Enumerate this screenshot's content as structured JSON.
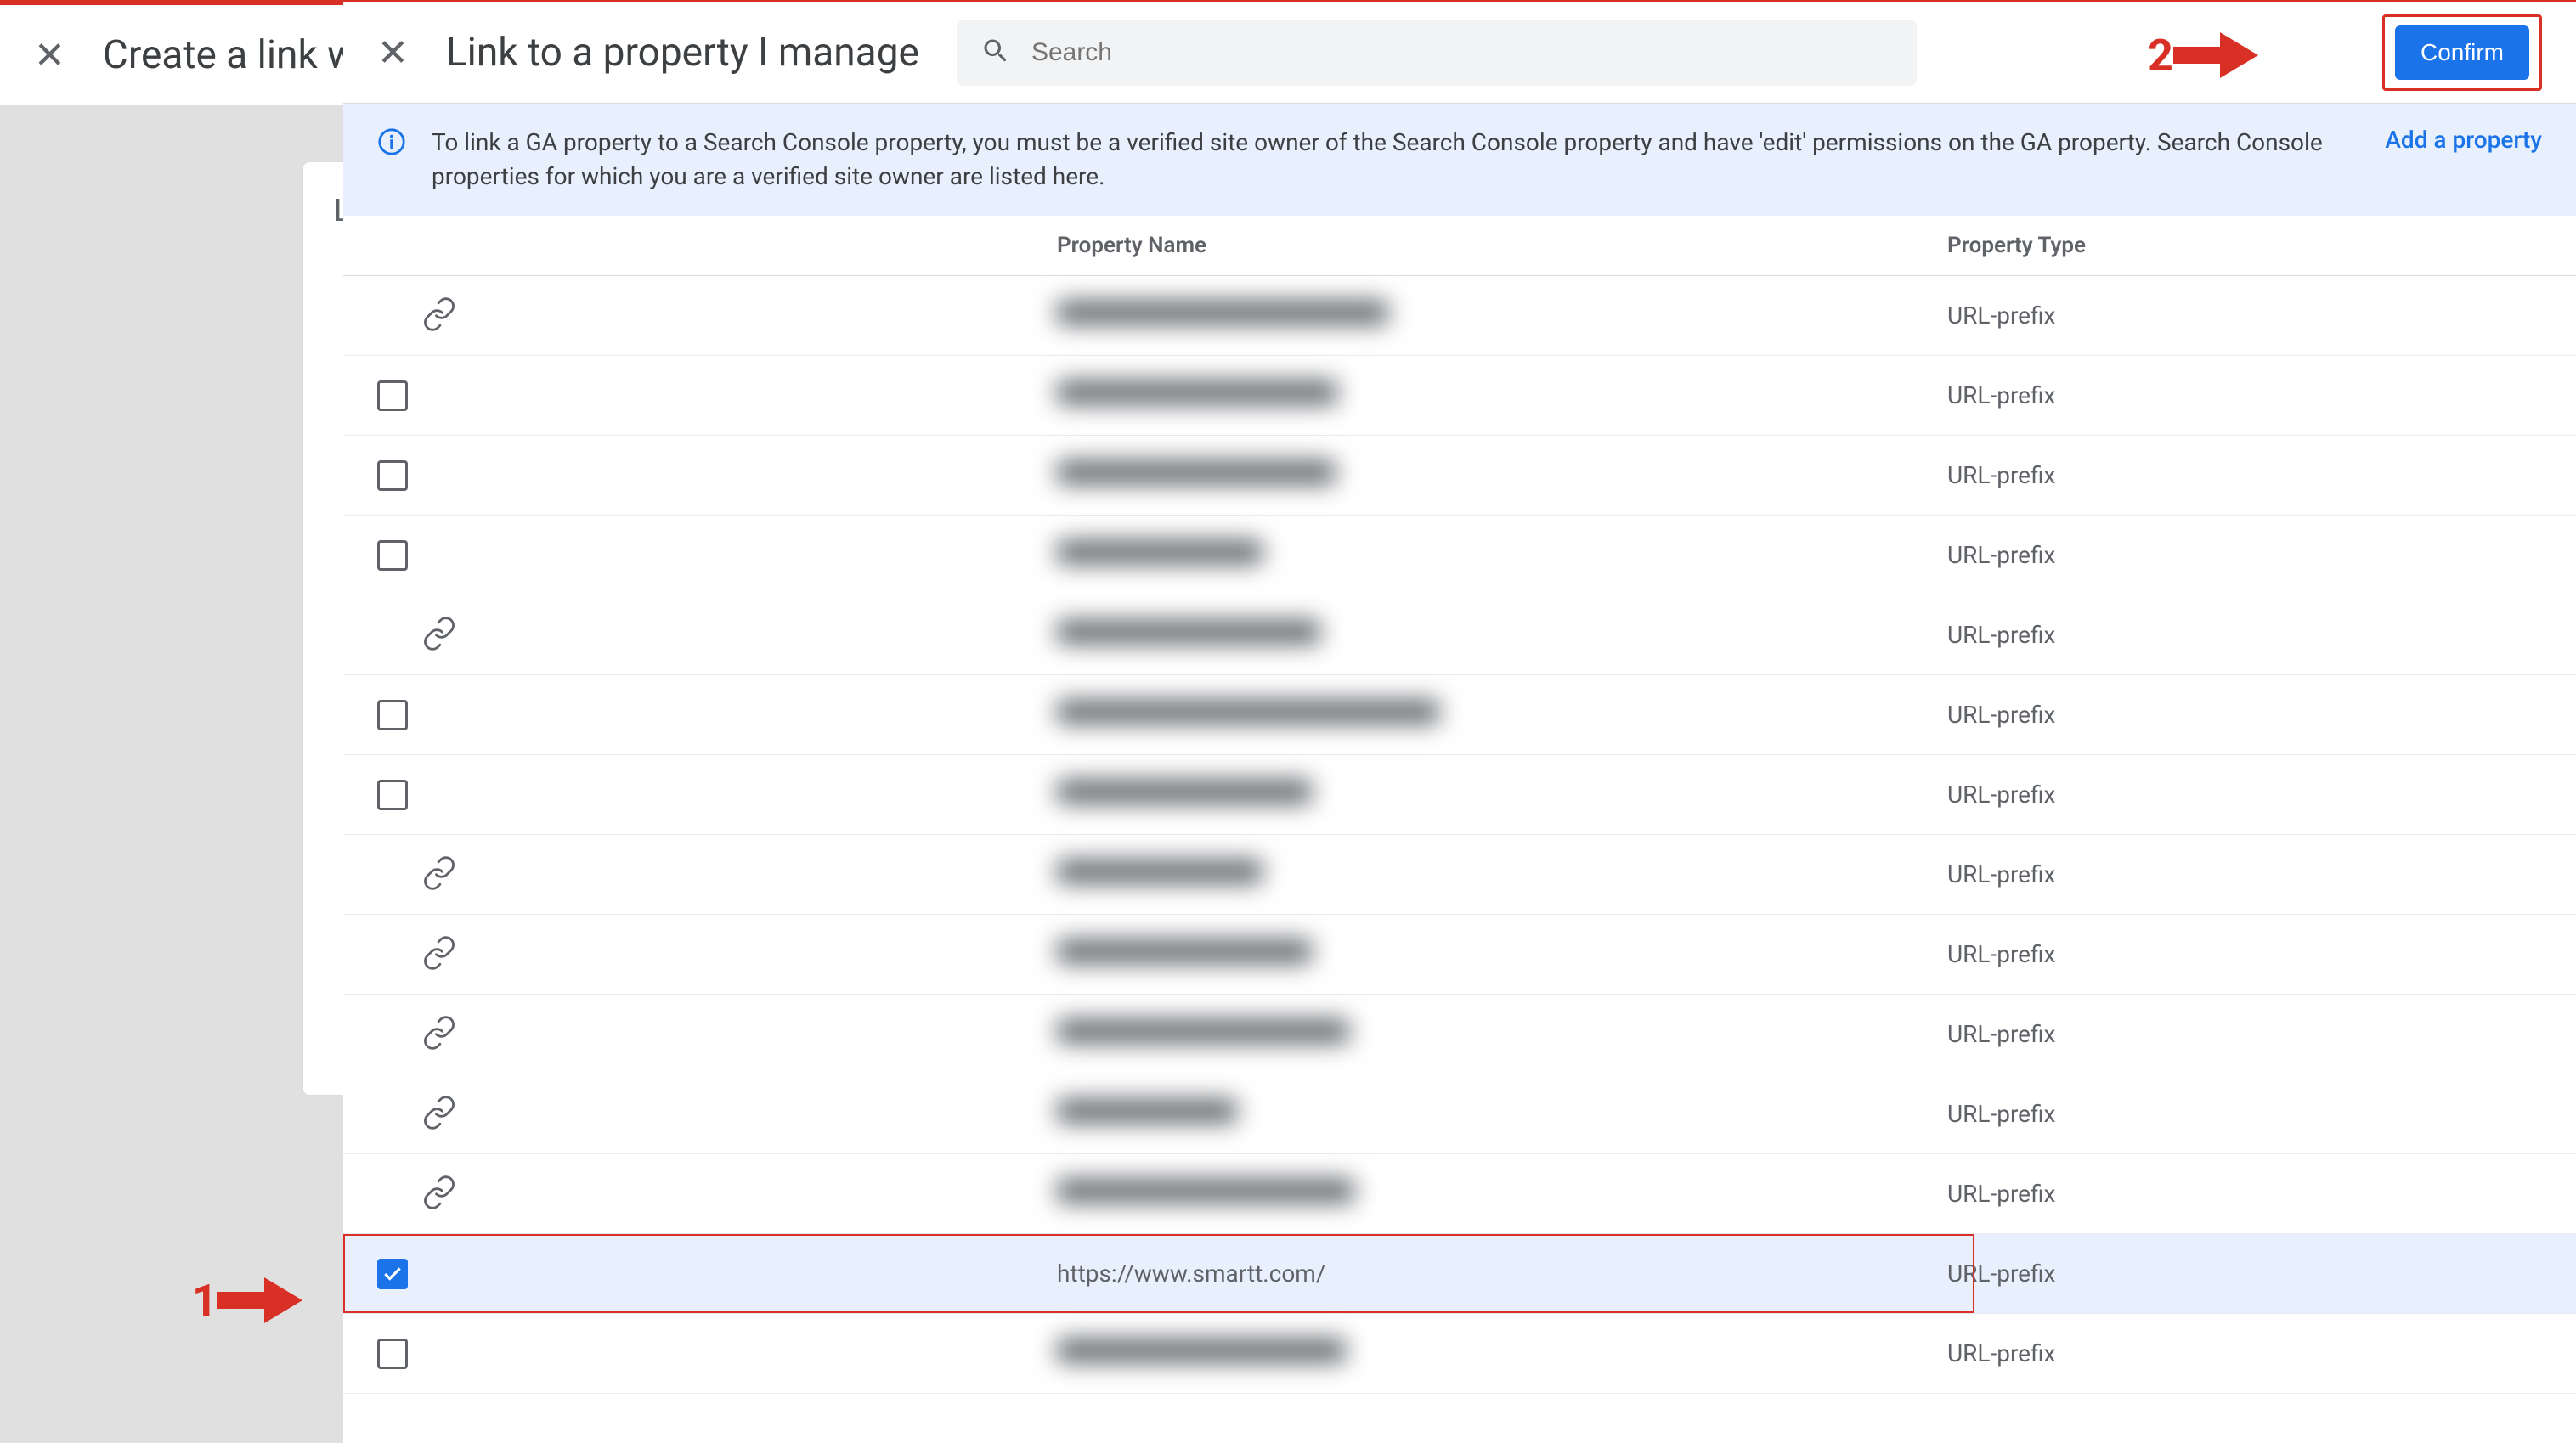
{
  "background": {
    "title": "Create a link w",
    "card_letter": "L"
  },
  "header": {
    "title": "Link to a property I manage",
    "search_placeholder": "Search",
    "confirm_label": "Confirm"
  },
  "info": {
    "text": "To link a GA property to a Search Console property, you must be a verified site owner of the Search Console property and have 'edit' permissions on the GA property. Search Console properties for which you are a verified site owner are listed here.",
    "add_link": "Add a property"
  },
  "table": {
    "name_header": "Property Name",
    "type_header": "Property Type"
  },
  "rows": [
    {
      "control": "link",
      "type": "URL-prefix",
      "name": "",
      "blurred": true,
      "bw": 390
    },
    {
      "control": "checkbox",
      "checked": false,
      "type": "URL-prefix",
      "name": "",
      "blurred": true,
      "bw": 330
    },
    {
      "control": "checkbox",
      "checked": false,
      "type": "URL-prefix",
      "name": "",
      "blurred": true,
      "bw": 328
    },
    {
      "control": "checkbox",
      "checked": false,
      "type": "URL-prefix",
      "name": "",
      "blurred": true,
      "bw": 242
    },
    {
      "control": "link",
      "type": "URL-prefix",
      "name": "",
      "blurred": true,
      "bw": 310
    },
    {
      "control": "checkbox",
      "checked": false,
      "type": "URL-prefix",
      "name": "",
      "blurred": true,
      "bw": 450
    },
    {
      "control": "checkbox",
      "checked": false,
      "type": "URL-prefix",
      "name": "",
      "blurred": true,
      "bw": 300
    },
    {
      "control": "link",
      "type": "URL-prefix",
      "name": "",
      "blurred": true,
      "bw": 242
    },
    {
      "control": "link",
      "type": "URL-prefix",
      "name": "",
      "blurred": true,
      "bw": 300
    },
    {
      "control": "link",
      "type": "URL-prefix",
      "name": "",
      "blurred": true,
      "bw": 344
    },
    {
      "control": "link",
      "type": "URL-prefix",
      "name": "",
      "blurred": true,
      "bw": 212
    },
    {
      "control": "link",
      "type": "URL-prefix",
      "name": "",
      "blurred": true,
      "bw": 350
    },
    {
      "control": "checkbox",
      "checked": true,
      "selected": true,
      "type": "URL-prefix",
      "name": "https://www.smartt.com/",
      "blurred": false
    },
    {
      "control": "checkbox",
      "checked": false,
      "type": "URL-prefix",
      "name": "",
      "blurred": true,
      "bw": 340
    }
  ],
  "annotations": {
    "one": "1",
    "two": "2"
  }
}
